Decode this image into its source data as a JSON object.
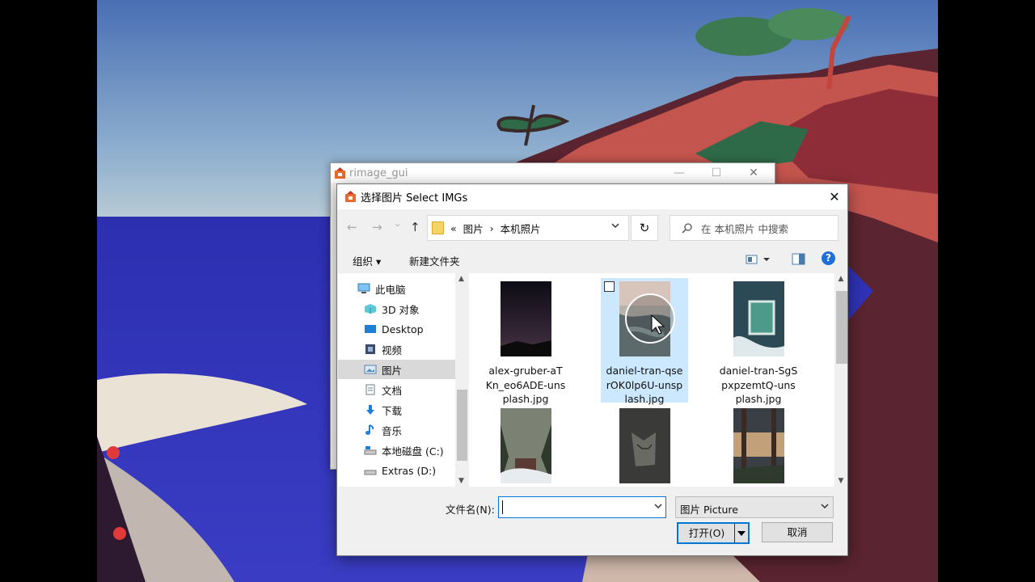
{
  "bg_window": {
    "title": "rimage_gui",
    "min": "—",
    "max": "☐",
    "close": "✕"
  },
  "dialog": {
    "title": "选择图片 Select IMGs",
    "close": "✕",
    "nav": {
      "back": "←",
      "forward": "→",
      "recent": "⌄",
      "up": "↑",
      "refresh": "↻"
    },
    "address": {
      "overflow": "«",
      "parts": [
        "图片",
        "本机照片"
      ],
      "sep": "›"
    },
    "search_placeholder": "在 本机照片 中搜索",
    "toolbar": {
      "organize": "组织 ▾",
      "new_folder": "新建文件夹",
      "help": "?"
    },
    "sidebar": [
      {
        "label": "此电脑",
        "icon": "pc-icon"
      },
      {
        "label": "3D 对象",
        "icon": "cube-icon"
      },
      {
        "label": "Desktop",
        "icon": "desktop-icon"
      },
      {
        "label": "视频",
        "icon": "video-icon"
      },
      {
        "label": "图片",
        "icon": "pictures-icon",
        "selected": true
      },
      {
        "label": "文档",
        "icon": "documents-icon"
      },
      {
        "label": "下载",
        "icon": "download-icon"
      },
      {
        "label": "音乐",
        "icon": "music-icon"
      },
      {
        "label": "本地磁盘 (C:)",
        "icon": "drive-icon"
      },
      {
        "label": "Extras (D:)",
        "icon": "drive-icon"
      }
    ],
    "files": [
      {
        "name": "alex-gruber-aTKn_eo6ADE-unsplash.jpg",
        "lines": [
          "alex-gruber-aT",
          "Kn_eo6ADE-uns",
          "plash.jpg"
        ]
      },
      {
        "name": "daniel-tran-qserOK0lp6U-unsplash.jpg",
        "lines": [
          "daniel-tran-qse",
          "rOK0lp6U-unsp",
          "lash.jpg"
        ],
        "selected": true
      },
      {
        "name": "daniel-tran-SgSpxpzemtQ-unsplash.jpg",
        "lines": [
          "daniel-tran-SgS",
          "pxpzemtQ-uns",
          "plash.jpg"
        ]
      },
      {
        "name": "",
        "lines": []
      },
      {
        "name": "",
        "lines": []
      },
      {
        "name": "",
        "lines": []
      }
    ],
    "filename_label": "文件名(N):",
    "filename_value": "",
    "filter": "图片 Picture",
    "open_button": "打开(O)",
    "cancel_button": "取消"
  }
}
